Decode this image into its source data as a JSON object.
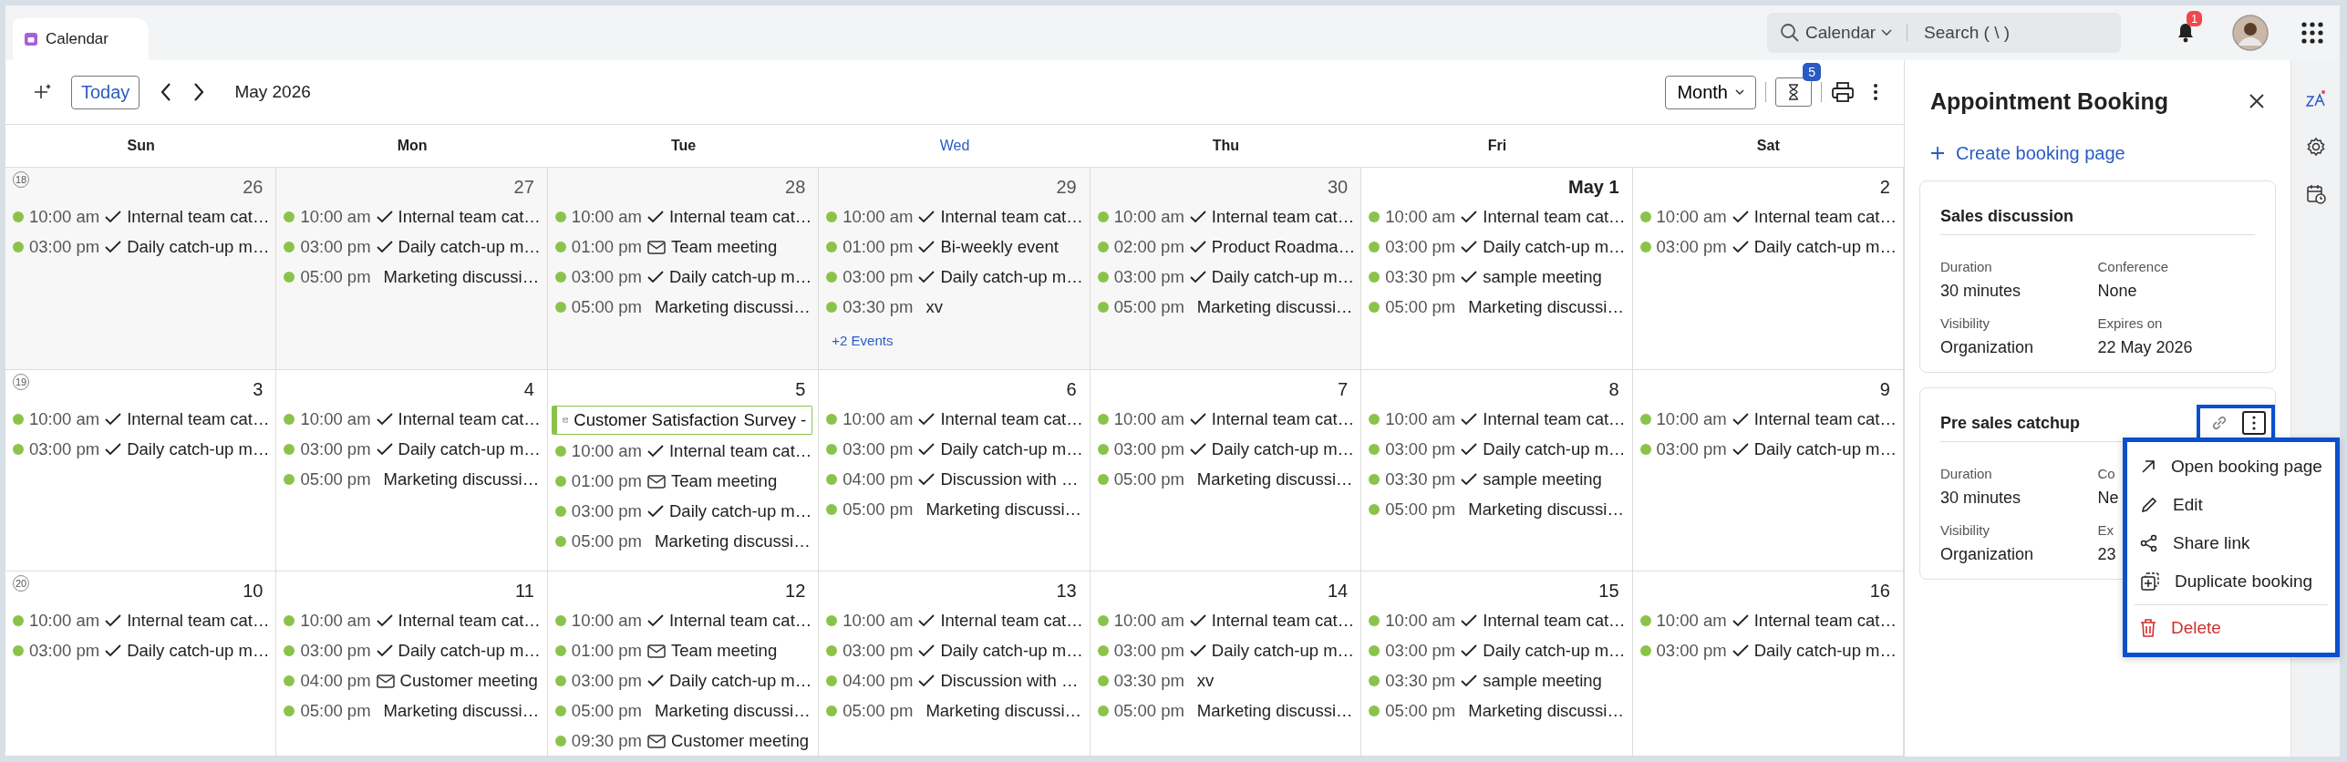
{
  "tab": {
    "label": "Calendar",
    "selected": true
  },
  "search": {
    "scope": "Calendar",
    "placeholder": "Search ( \\ )"
  },
  "notifications": {
    "count": "1"
  },
  "toolbar": {
    "today": "Today",
    "period": "May 2026",
    "view": "Month",
    "pending_count": "5"
  },
  "weekdays": [
    {
      "label": "Sun",
      "today": false
    },
    {
      "label": "Mon",
      "today": false
    },
    {
      "label": "Tue",
      "today": false
    },
    {
      "label": "Wed",
      "today": true
    },
    {
      "label": "Thu",
      "today": false
    },
    {
      "label": "Fri",
      "today": false
    },
    {
      "label": "Sat",
      "today": false
    }
  ],
  "weeks": [
    {
      "number": "18",
      "days": [
        {
          "date": "26",
          "other_month": true,
          "month_start": false,
          "events": [
            {
              "time": "10:00 am",
              "kind": "check",
              "title": "Internal team cat…"
            },
            {
              "time": "03:00 pm",
              "kind": "check",
              "title": "Daily catch-up m…"
            }
          ]
        },
        {
          "date": "27",
          "other_month": true,
          "month_start": false,
          "events": [
            {
              "time": "10:00 am",
              "kind": "check",
              "title": "Internal team cat…"
            },
            {
              "time": "03:00 pm",
              "kind": "check",
              "title": "Daily catch-up m…"
            },
            {
              "time": "05:00 pm",
              "kind": "plain",
              "title": "Marketing discussi…"
            }
          ]
        },
        {
          "date": "28",
          "other_month": true,
          "month_start": false,
          "events": [
            {
              "time": "10:00 am",
              "kind": "check",
              "title": "Internal team cat…"
            },
            {
              "time": "01:00 pm",
              "kind": "mail",
              "title": "Team meeting"
            },
            {
              "time": "03:00 pm",
              "kind": "check",
              "title": "Daily catch-up m…"
            },
            {
              "time": "05:00 pm",
              "kind": "plain",
              "title": "Marketing discussi…"
            }
          ]
        },
        {
          "date": "29",
          "other_month": true,
          "month_start": false,
          "events": [
            {
              "time": "10:00 am",
              "kind": "check",
              "title": "Internal team cat…"
            },
            {
              "time": "01:00 pm",
              "kind": "check",
              "title": "Bi-weekly event"
            },
            {
              "time": "03:00 pm",
              "kind": "check",
              "title": "Daily catch-up m…"
            },
            {
              "time": "03:30 pm",
              "kind": "plain",
              "title": "xv"
            }
          ],
          "more": "+2 Events"
        },
        {
          "date": "30",
          "other_month": true,
          "month_start": false,
          "events": [
            {
              "time": "10:00 am",
              "kind": "check",
              "title": "Internal team cat…"
            },
            {
              "time": "02:00 pm",
              "kind": "check",
              "title": "Product Roadma…"
            },
            {
              "time": "03:00 pm",
              "kind": "check",
              "title": "Daily catch-up m…"
            },
            {
              "time": "05:00 pm",
              "kind": "plain",
              "title": "Marketing discussi…"
            }
          ]
        },
        {
          "date": "May 1",
          "other_month": false,
          "month_start": true,
          "events": [
            {
              "time": "10:00 am",
              "kind": "check",
              "title": "Internal team cat…"
            },
            {
              "time": "03:00 pm",
              "kind": "check",
              "title": "Daily catch-up m…"
            },
            {
              "time": "03:30 pm",
              "kind": "check",
              "title": "sample meeting"
            },
            {
              "time": "05:00 pm",
              "kind": "plain",
              "title": "Marketing discussi…"
            }
          ]
        },
        {
          "date": "2",
          "other_month": false,
          "month_start": false,
          "events": [
            {
              "time": "10:00 am",
              "kind": "check",
              "title": "Internal team cat…"
            },
            {
              "time": "03:00 pm",
              "kind": "check",
              "title": "Daily catch-up m…"
            }
          ]
        }
      ]
    },
    {
      "number": "19",
      "days": [
        {
          "date": "3",
          "other_month": false,
          "month_start": false,
          "events": [
            {
              "time": "10:00 am",
              "kind": "check",
              "title": "Internal team cat…"
            },
            {
              "time": "03:00 pm",
              "kind": "check",
              "title": "Daily catch-up m…"
            }
          ]
        },
        {
          "date": "4",
          "other_month": false,
          "month_start": false,
          "events": [
            {
              "time": "10:00 am",
              "kind": "check",
              "title": "Internal team cat…"
            },
            {
              "time": "03:00 pm",
              "kind": "check",
              "title": "Daily catch-up m…"
            },
            {
              "time": "05:00 pm",
              "kind": "plain",
              "title": "Marketing discussi…"
            }
          ]
        },
        {
          "date": "5",
          "other_month": false,
          "month_start": false,
          "events": [
            {
              "kind": "allday",
              "title": "Customer Satisfaction Survey -"
            },
            {
              "time": "10:00 am",
              "kind": "check",
              "title": "Internal team cat…"
            },
            {
              "time": "01:00 pm",
              "kind": "mail",
              "title": "Team meeting"
            },
            {
              "time": "03:00 pm",
              "kind": "check",
              "title": "Daily catch-up m…"
            },
            {
              "time": "05:00 pm",
              "kind": "plain",
              "title": "Marketing discussi…"
            }
          ]
        },
        {
          "date": "6",
          "other_month": false,
          "month_start": false,
          "events": [
            {
              "time": "10:00 am",
              "kind": "check",
              "title": "Internal team cat…"
            },
            {
              "time": "03:00 pm",
              "kind": "check",
              "title": "Daily catch-up m…"
            },
            {
              "time": "04:00 pm",
              "kind": "check",
              "title": "Discussion with …"
            },
            {
              "time": "05:00 pm",
              "kind": "plain",
              "title": "Marketing discussi…"
            }
          ]
        },
        {
          "date": "7",
          "other_month": false,
          "month_start": false,
          "events": [
            {
              "time": "10:00 am",
              "kind": "check",
              "title": "Internal team cat…"
            },
            {
              "time": "03:00 pm",
              "kind": "check",
              "title": "Daily catch-up m…"
            },
            {
              "time": "05:00 pm",
              "kind": "plain",
              "title": "Marketing discussi…"
            }
          ]
        },
        {
          "date": "8",
          "other_month": false,
          "month_start": false,
          "events": [
            {
              "time": "10:00 am",
              "kind": "check",
              "title": "Internal team cat…"
            },
            {
              "time": "03:00 pm",
              "kind": "check",
              "title": "Daily catch-up m…"
            },
            {
              "time": "03:30 pm",
              "kind": "check",
              "title": "sample meeting"
            },
            {
              "time": "05:00 pm",
              "kind": "plain",
              "title": "Marketing discussi…"
            }
          ]
        },
        {
          "date": "9",
          "other_month": false,
          "month_start": false,
          "events": [
            {
              "time": "10:00 am",
              "kind": "check",
              "title": "Internal team cat…"
            },
            {
              "time": "03:00 pm",
              "kind": "check",
              "title": "Daily catch-up m…"
            }
          ]
        }
      ]
    },
    {
      "number": "20",
      "days": [
        {
          "date": "10",
          "other_month": false,
          "month_start": false,
          "events": [
            {
              "time": "10:00 am",
              "kind": "check",
              "title": "Internal team cat…"
            },
            {
              "time": "03:00 pm",
              "kind": "check",
              "title": "Daily catch-up m…"
            }
          ]
        },
        {
          "date": "11",
          "other_month": false,
          "month_start": false,
          "events": [
            {
              "time": "10:00 am",
              "kind": "check",
              "title": "Internal team cat…"
            },
            {
              "time": "03:00 pm",
              "kind": "check",
              "title": "Daily catch-up m…"
            },
            {
              "time": "04:00 pm",
              "kind": "mail",
              "title": "Customer meeting"
            },
            {
              "time": "05:00 pm",
              "kind": "plain",
              "title": "Marketing discussi…"
            }
          ]
        },
        {
          "date": "12",
          "other_month": false,
          "month_start": false,
          "events": [
            {
              "time": "10:00 am",
              "kind": "check",
              "title": "Internal team cat…"
            },
            {
              "time": "01:00 pm",
              "kind": "mail",
              "title": "Team meeting"
            },
            {
              "time": "03:00 pm",
              "kind": "check",
              "title": "Daily catch-up m…"
            },
            {
              "time": "05:00 pm",
              "kind": "plain",
              "title": "Marketing discussi…"
            },
            {
              "time": "09:30 pm",
              "kind": "mail",
              "title": "Customer meeting"
            }
          ]
        },
        {
          "date": "13",
          "other_month": false,
          "month_start": false,
          "events": [
            {
              "time": "10:00 am",
              "kind": "check",
              "title": "Internal team cat…"
            },
            {
              "time": "03:00 pm",
              "kind": "check",
              "title": "Daily catch-up m…"
            },
            {
              "time": "04:00 pm",
              "kind": "check",
              "title": "Discussion with …"
            },
            {
              "time": "05:00 pm",
              "kind": "plain",
              "title": "Marketing discussi…"
            }
          ]
        },
        {
          "date": "14",
          "other_month": false,
          "month_start": false,
          "events": [
            {
              "time": "10:00 am",
              "kind": "check",
              "title": "Internal team cat…"
            },
            {
              "time": "03:00 pm",
              "kind": "check",
              "title": "Daily catch-up m…"
            },
            {
              "time": "03:30 pm",
              "kind": "plain",
              "title": "xv"
            },
            {
              "time": "05:00 pm",
              "kind": "plain",
              "title": "Marketing discussi…"
            }
          ]
        },
        {
          "date": "15",
          "other_month": false,
          "month_start": false,
          "events": [
            {
              "time": "10:00 am",
              "kind": "check",
              "title": "Internal team cat…"
            },
            {
              "time": "03:00 pm",
              "kind": "check",
              "title": "Daily catch-up m…"
            },
            {
              "time": "03:30 pm",
              "kind": "check",
              "title": "sample meeting"
            },
            {
              "time": "05:00 pm",
              "kind": "plain",
              "title": "Marketing discussi…"
            }
          ]
        },
        {
          "date": "16",
          "other_month": false,
          "month_start": false,
          "events": [
            {
              "time": "10:00 am",
              "kind": "check",
              "title": "Internal team cat…"
            },
            {
              "time": "03:00 pm",
              "kind": "check",
              "title": "Daily catch-up m…"
            }
          ]
        }
      ]
    }
  ],
  "panel": {
    "title": "Appointment Booking",
    "create_link": "Create booking page",
    "cards": [
      {
        "title": "Sales discussion",
        "actions": false,
        "fields": [
          {
            "label": "Duration",
            "value": "30 minutes"
          },
          {
            "label": "Conference",
            "value": "None"
          },
          {
            "label": "Visibility",
            "value": "Organization"
          },
          {
            "label": "Expires on",
            "value": "22 May 2026"
          }
        ]
      },
      {
        "title": "Pre sales catchup",
        "actions": true,
        "fields": [
          {
            "label": "Duration",
            "value": "30 minutes"
          },
          {
            "label": "Co",
            "value": "Ne"
          },
          {
            "label": "Visibility",
            "value": "Organization"
          },
          {
            "label": "Ex",
            "value": "23"
          }
        ]
      }
    ]
  },
  "menu": [
    {
      "kind": "open",
      "label": "Open booking page"
    },
    {
      "kind": "edit",
      "label": "Edit"
    },
    {
      "kind": "share",
      "label": "Share link"
    },
    {
      "kind": "duplicate",
      "label": "Duplicate booking"
    },
    {
      "kind": "delete",
      "label": "Delete"
    }
  ]
}
